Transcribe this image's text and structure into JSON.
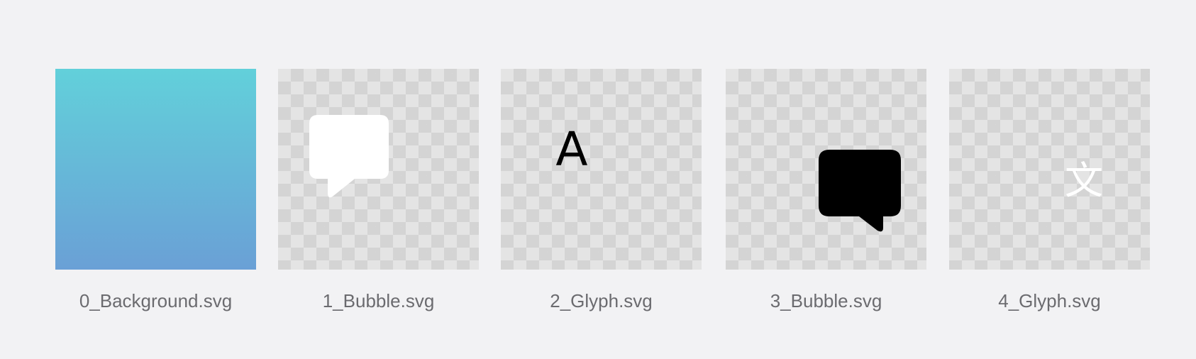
{
  "files": [
    {
      "name": "0_Background.svg",
      "icon": "gradient-background"
    },
    {
      "name": "1_Bubble.svg",
      "icon": "speech-bubble-white"
    },
    {
      "name": "2_Glyph.svg",
      "icon": "latin-glyph",
      "glyph_text": "A"
    },
    {
      "name": "3_Bubble.svg",
      "icon": "speech-bubble-black"
    },
    {
      "name": "4_Glyph.svg",
      "icon": "cjk-glyph",
      "glyph_text": "文"
    }
  ],
  "colors": {
    "page_background": "#f2f2f4",
    "gradient_top": "#62d0da",
    "gradient_bottom": "#6aa0d6",
    "label_text": "#6b6b6f"
  }
}
